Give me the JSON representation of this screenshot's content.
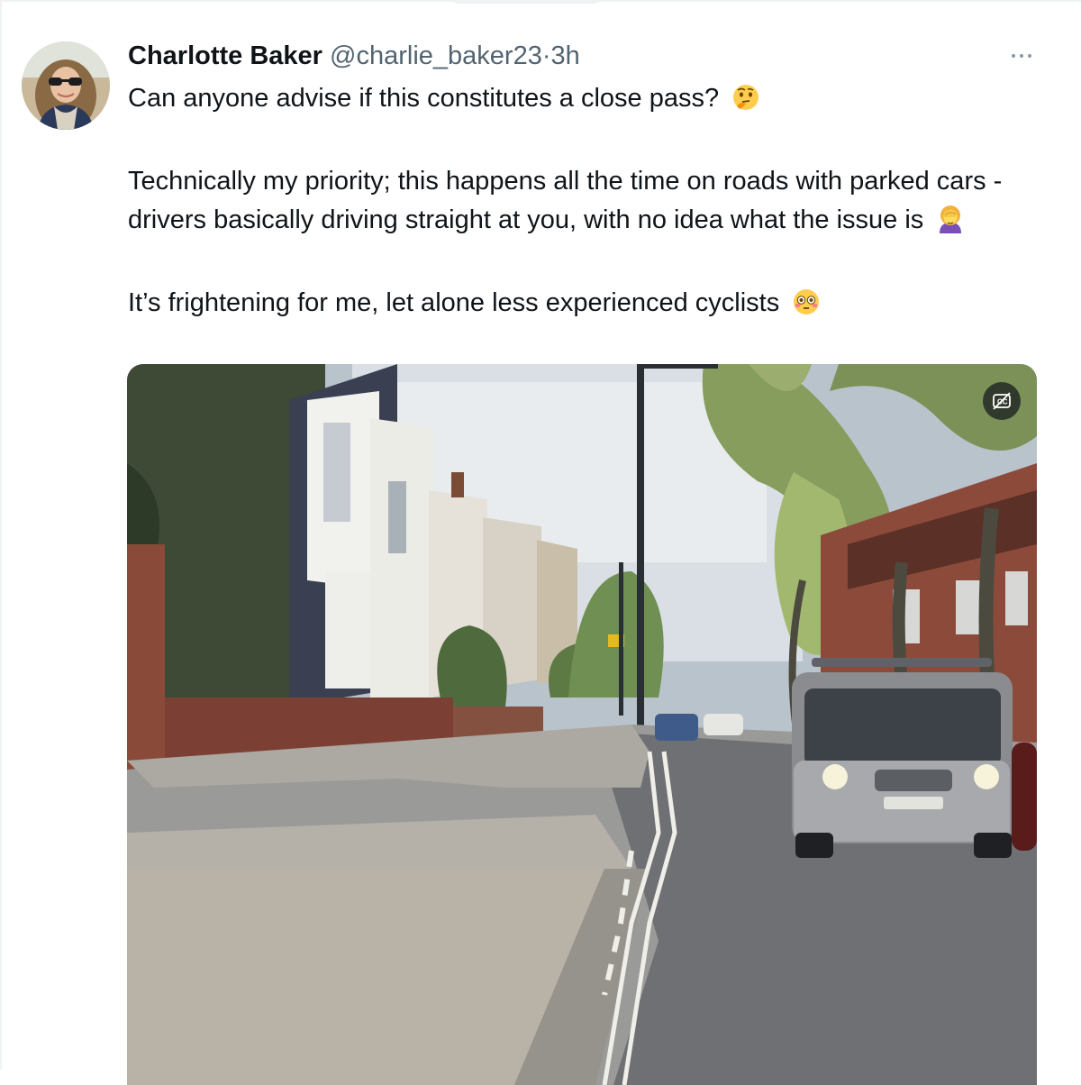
{
  "tweet": {
    "author_name": "Charlotte Baker",
    "handle": "@charlie_baker23",
    "separator": "·",
    "time": "3h",
    "paragraphs": [
      "Can anyone advise if this constitutes a close pass?",
      "Technically my priority; this happens all the time on roads with parked cars - drivers basically driving straight at you, with no idea what the issue is",
      "It’s frightening for me, let alone less experienced cyclists"
    ],
    "emojis": [
      "thinking-face-emoji",
      "face-palm-emoji",
      "flushed-face-emoji"
    ]
  },
  "media": {
    "type": "video",
    "subject": "residential street with parked cars and an oncoming silver car",
    "captions_control_icon": "captions-off-icon"
  },
  "colors": {
    "text": "#0f1419",
    "secondary_text": "#536471",
    "border": "#eff3f4"
  }
}
